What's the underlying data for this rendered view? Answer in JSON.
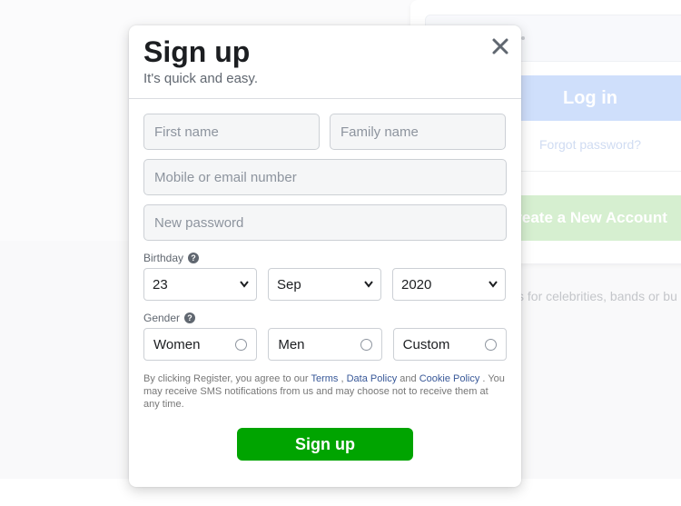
{
  "background": {
    "login_label": "Log in",
    "forgot_label": "Forgot password?",
    "create_label": "Create a New Account",
    "tagline": "s for celebrities, bands or bu"
  },
  "modal": {
    "title": "Sign up",
    "subtitle": "It's quick and easy.",
    "close_icon": "close-icon"
  },
  "form": {
    "first_name": {
      "placeholder": "First name",
      "value": ""
    },
    "family_name": {
      "placeholder": "Family name",
      "value": ""
    },
    "contact": {
      "placeholder": "Mobile or email number",
      "value": ""
    },
    "password": {
      "placeholder": "New password",
      "value": ""
    },
    "birthday": {
      "label": "Birthday",
      "day": "23",
      "month": "Sep",
      "year": "2020"
    },
    "gender": {
      "label": "Gender",
      "options": [
        "Women",
        "Men",
        "Custom"
      ]
    },
    "terms": {
      "prefix": "By clicking Register, you agree to our",
      "terms_link": "Terms",
      "sep": ",",
      "data_policy_link": "Data Policy",
      "and": "and",
      "cookie_policy_link": "Cookie Policy",
      "suffix": ". You may receive SMS notifications from us and may choose not to receive them at any time."
    },
    "submit_label": "Sign up"
  },
  "colors": {
    "primary_green": "#00a400",
    "link_blue": "#385898",
    "input_bg": "#f5f6f7"
  }
}
